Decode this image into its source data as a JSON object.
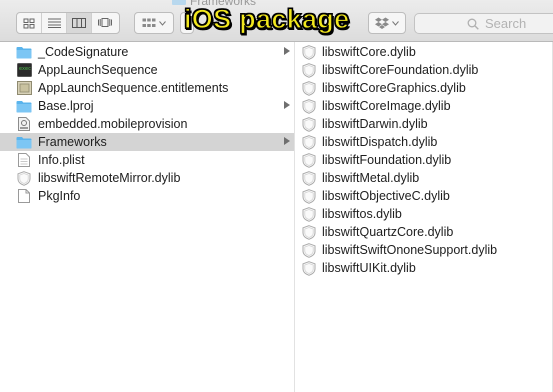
{
  "window": {
    "title": "Frameworks"
  },
  "overlay": {
    "caption": "iOS package"
  },
  "toolbar": {
    "view_buttons": [
      "icon-view",
      "list-view",
      "column-view",
      "cover-flow-view"
    ],
    "active_view": "column-view",
    "search_placeholder": "Search"
  },
  "left_column": {
    "items": [
      {
        "name": "_CodeSignature",
        "icon": "folder-icon",
        "has_children": true,
        "selected": false
      },
      {
        "name": "AppLaunchSequence",
        "icon": "executable-icon",
        "has_children": false,
        "selected": false
      },
      {
        "name": "AppLaunchSequence.entitlements",
        "icon": "document-icon",
        "has_children": false,
        "selected": false
      },
      {
        "name": "Base.lproj",
        "icon": "folder-icon",
        "has_children": true,
        "selected": false
      },
      {
        "name": "embedded.mobileprovision",
        "icon": "provision-icon",
        "has_children": false,
        "selected": false
      },
      {
        "name": "Frameworks",
        "icon": "folder-icon",
        "has_children": true,
        "selected": true
      },
      {
        "name": "Info.plist",
        "icon": "plist-icon",
        "has_children": false,
        "selected": false
      },
      {
        "name": "libswiftRemoteMirror.dylib",
        "icon": "dylib-icon",
        "has_children": false,
        "selected": false
      },
      {
        "name": "PkgInfo",
        "icon": "blank-file-icon",
        "has_children": false,
        "selected": false
      }
    ]
  },
  "right_column": {
    "items": [
      "libswiftCore.dylib",
      "libswiftCoreFoundation.dylib",
      "libswiftCoreGraphics.dylib",
      "libswiftCoreImage.dylib",
      "libswiftDarwin.dylib",
      "libswiftDispatch.dylib",
      "libswiftFoundation.dylib",
      "libswiftMetal.dylib",
      "libswiftObjectiveC.dylib",
      "libswiftos.dylib",
      "libswiftQuartzCore.dylib",
      "libswiftSwiftOnoneSupport.dylib",
      "libswiftUIKit.dylib"
    ]
  },
  "colors": {
    "folder": "#5ab4ec",
    "selection": "#d4d4d4",
    "overlay_text": "#f2e81e"
  }
}
